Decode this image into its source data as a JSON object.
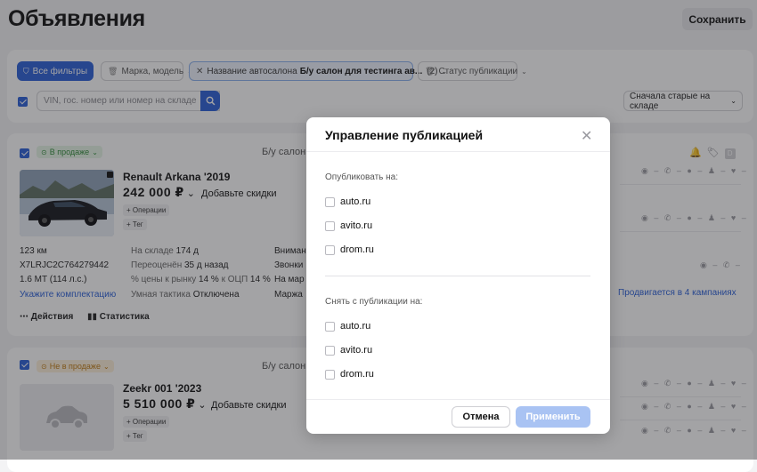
{
  "page": {
    "title": "Объявления",
    "save_label": "Сохранить"
  },
  "filters": {
    "all_filters": "Все фильтры",
    "brand_model": "Марка, модель",
    "salon_label": "Название автосалона",
    "salon_value": "Б/у салон для тестинга ав...",
    "salon_count": "(2)",
    "publication_status": "Статус публикации",
    "search_placeholder": "VIN, гос. номер или номер на складе",
    "sort_label": "Сначала старые на складе"
  },
  "cards": [
    {
      "status": "В продаже",
      "salon": "Б/у салон д",
      "title": "Renault Arkana '2019",
      "price": "242 000 ₽",
      "discount": "Добавьте скидки",
      "operations": "+ Операции",
      "tag": "+ Тег",
      "mileage": "123 км",
      "vin": "X7LRJC2C764279442",
      "engine": "1.6 MT (114 л.с.)",
      "complectation_link": "Укажите комплектацию",
      "stock_label": "На складе",
      "stock_value": "174 д",
      "reprice_label": "Переоценён",
      "reprice_value": "35 д назад",
      "market_label": "% цены к рынку",
      "market_value": "14 %",
      "ocp_label": "к ОЦП",
      "ocp_value": "14 %",
      "tactic_label": "Умная тактика",
      "tactic_value": "Отключена",
      "col3": [
        "Вниман",
        "Звонки",
        "На мар",
        "Маржа"
      ],
      "actions": "Действия",
      "statistics": "Статистика",
      "promo": "Продвигается в 4 кампаниях"
    },
    {
      "status": "Не в продаже",
      "salon": "Б/у салон д",
      "title": "Zeekr 001 '2023",
      "price": "5 510 000 ₽",
      "discount": "Добавьте скидки",
      "operations": "+ Операции",
      "tag": "+ Тег"
    }
  ],
  "icon_row_text": "◉ – ✆ – ● – ♟ – ♥ –",
  "icon_row_short": "◉ – ✆ –",
  "modal": {
    "title": "Управление публикацией",
    "publish_on": "Опубликовать на:",
    "unpublish_from": "Снять с публикации на:",
    "publish_options": [
      "auto.ru",
      "avito.ru",
      "drom.ru"
    ],
    "unpublish_options": [
      "auto.ru",
      "avito.ru",
      "drom.ru"
    ],
    "cancel": "Отмена",
    "apply": "Применить"
  },
  "colors": {
    "accent": "#2a5fd8",
    "apply_disabled": "#a9c3f3",
    "sale_green": "#2f8a38",
    "nosale_orange": "#c07a12"
  }
}
